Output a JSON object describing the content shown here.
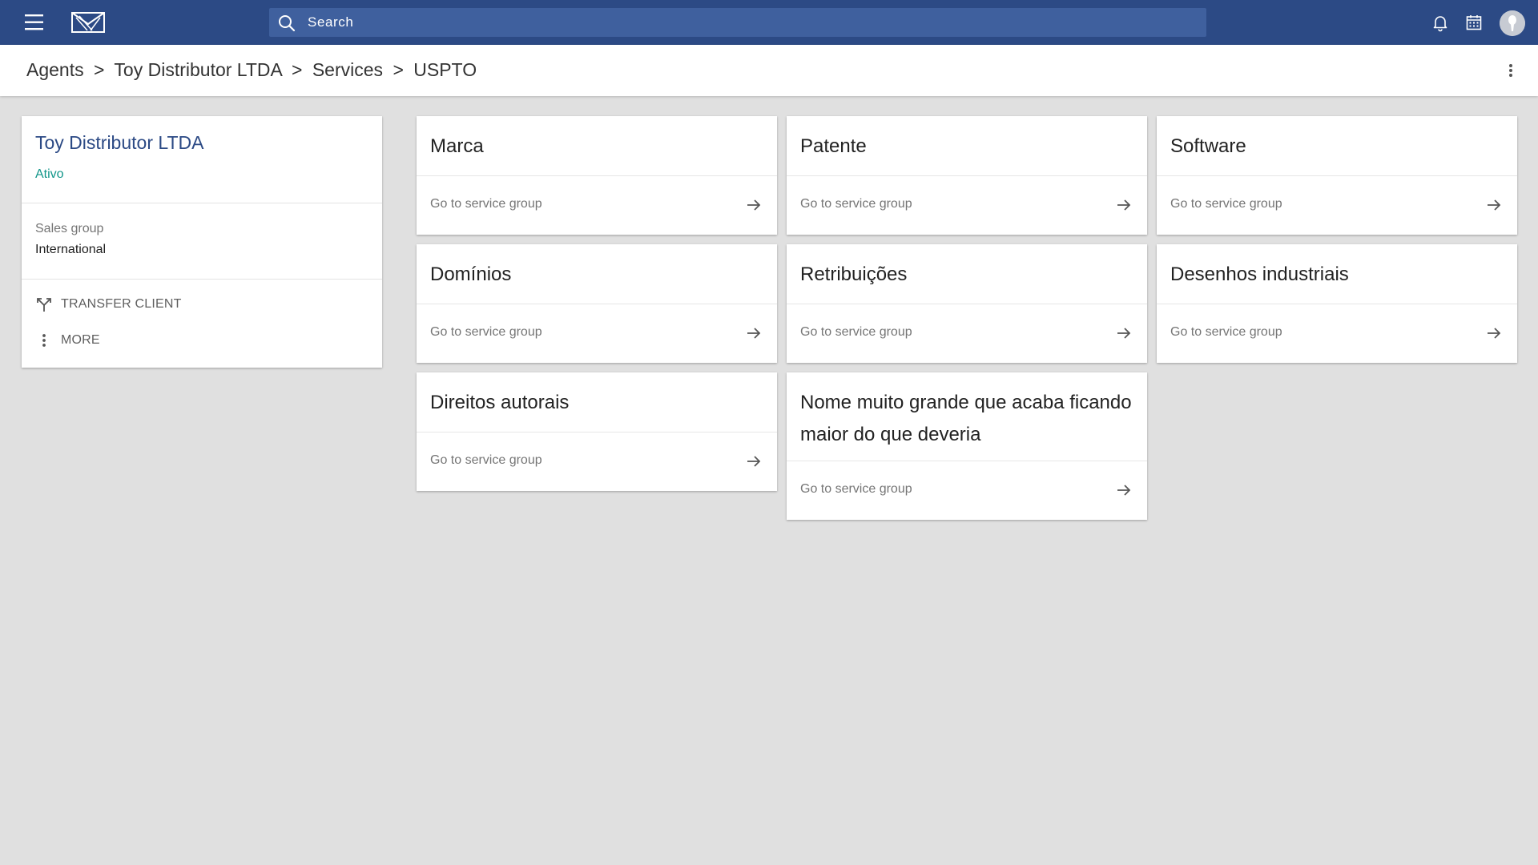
{
  "topbar": {
    "search_placeholder": "Search",
    "icons": [
      "menu-icon",
      "logo",
      "search-icon",
      "bell-icon",
      "calendar-icon",
      "avatar"
    ]
  },
  "breadcrumb": {
    "items": [
      "Agents",
      "Toy Distributor LTDA",
      "Services",
      "USPTO"
    ],
    "separator": ">"
  },
  "client": {
    "name": "Toy Distributor LTDA",
    "status": "Ativo",
    "sales_group_label": "Sales group",
    "sales_group_value": "International",
    "transfer_label": "TRANSFER CLIENT",
    "more_label": "MORE"
  },
  "services": {
    "goto_label": "Go to service group",
    "items": [
      {
        "title": "Marca"
      },
      {
        "title": "Patente"
      },
      {
        "title": "Software"
      },
      {
        "title": "Domínios"
      },
      {
        "title": "Retribuições"
      },
      {
        "title": "Desenhos industriais"
      },
      {
        "title": "Direitos autorais"
      },
      {
        "title": "Nome muito grande que acaba ficando maior do que deveria"
      }
    ]
  },
  "colors": {
    "topbar": "#2c4a85",
    "search_bg": "#3f609e",
    "accent": "#2c4a85",
    "status_active": "#12968a",
    "background": "#e0e0e0"
  }
}
